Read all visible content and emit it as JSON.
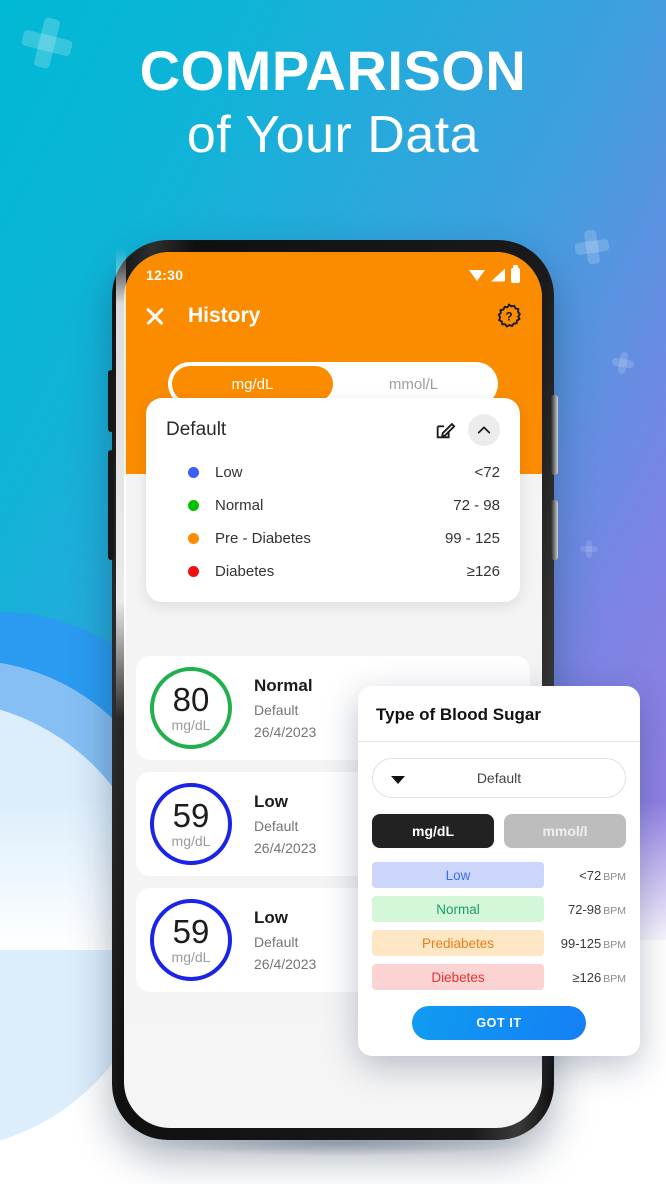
{
  "hero": {
    "line1": "COMPARISON",
    "line2": "of Your Data"
  },
  "colors": {
    "brand_orange": "#fb8c00",
    "accent_blue": "#1580f5",
    "low": "#3b5ef5",
    "normal": "#00c000",
    "pre_diabetes": "#ff8c00",
    "diabetes": "#f01010"
  },
  "phone": {
    "status_bar": {
      "time": "12:30",
      "icons": [
        "wifi-icon",
        "signal-icon",
        "battery-icon"
      ]
    },
    "header": {
      "close_icon": "close-icon",
      "title": "History",
      "help_icon": "help-badge-icon"
    },
    "unit_toggle": {
      "options": [
        "mg/dL",
        "mmol/L"
      ],
      "selected": "mg/dL"
    },
    "legend_card": {
      "title": "Default",
      "edit_icon": "edit-icon",
      "collapse_icon": "chevron-up-icon",
      "rows": [
        {
          "label": "Low",
          "range": "<72",
          "color": "#3b5ef5"
        },
        {
          "label": "Normal",
          "range": "72 - 98",
          "color": "#00c000"
        },
        {
          "label": "Pre - Diabetes",
          "range": "99 - 125",
          "color": "#ff8c00"
        },
        {
          "label": "Diabetes",
          "range": "≥126",
          "color": "#f01010"
        }
      ]
    },
    "history": [
      {
        "value": "80",
        "unit": "mg/dL",
        "status": "Normal",
        "type": "Default",
        "date": "26/4/2023",
        "ring_color": "#22b04f"
      },
      {
        "value": "59",
        "unit": "mg/dL",
        "status": "Low",
        "type": "Default",
        "date": "26/4/2023",
        "ring_color": "#1a23e8"
      },
      {
        "value": "59",
        "unit": "mg/dL",
        "status": "Low",
        "type": "Default",
        "date": "26/4/2023",
        "ring_color": "#1a23e8"
      }
    ]
  },
  "dialog": {
    "title": "Type of Blood Sugar",
    "select": {
      "value": "Default",
      "caret_icon": "chevron-down-icon"
    },
    "units": {
      "options": [
        "mg/dL",
        "mmol/l"
      ],
      "selected": "mg/dL"
    },
    "ranges": [
      {
        "label": "Low",
        "range": "<72",
        "unit": "BPM",
        "bg": "#ccd6fa",
        "fg": "#3b6ef5"
      },
      {
        "label": "Normal",
        "range": "72-98",
        "unit": "BPM",
        "bg": "#d4f7d9",
        "fg": "#1d9c6b"
      },
      {
        "label": "Prediabetes",
        "range": "99-125",
        "unit": "BPM",
        "bg": "#fde7c4",
        "fg": "#f07c15"
      },
      {
        "label": "Diebetes",
        "range": "≥126",
        "unit": "BPM",
        "bg": "#fbd3d3",
        "fg": "#ef3030"
      }
    ],
    "cta": "GOT IT"
  }
}
